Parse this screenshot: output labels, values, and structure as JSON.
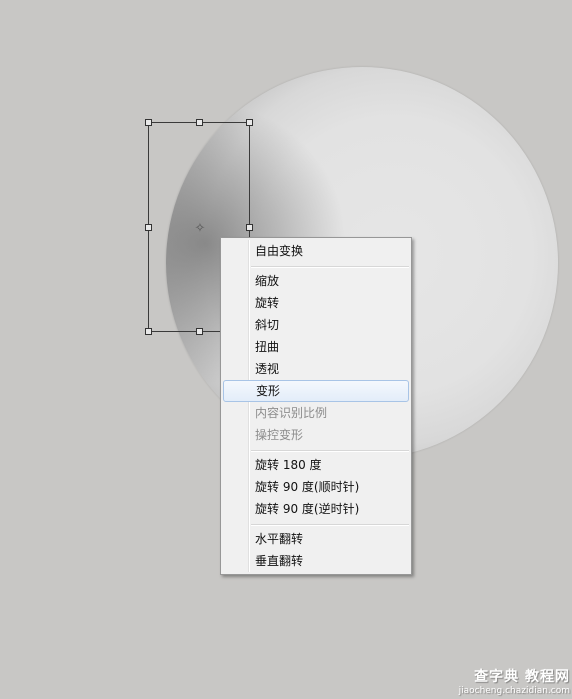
{
  "context_menu": {
    "groups": [
      {
        "items": [
          {
            "label": "自由变换",
            "enabled": true
          }
        ]
      },
      {
        "items": [
          {
            "label": "缩放",
            "enabled": true
          },
          {
            "label": "旋转",
            "enabled": true
          },
          {
            "label": "斜切",
            "enabled": true
          },
          {
            "label": "扭曲",
            "enabled": true
          },
          {
            "label": "透视",
            "enabled": true
          },
          {
            "label": "变形",
            "enabled": true,
            "highlighted": true
          },
          {
            "label": "内容识别比例",
            "enabled": false
          },
          {
            "label": "操控变形",
            "enabled": false
          }
        ]
      },
      {
        "items": [
          {
            "label": "旋转 180 度",
            "enabled": true
          },
          {
            "label": "旋转 90 度(顺时针)",
            "enabled": true
          },
          {
            "label": "旋转 90 度(逆时针)",
            "enabled": true
          }
        ]
      },
      {
        "items": [
          {
            "label": "水平翻转",
            "enabled": true
          },
          {
            "label": "垂直翻转",
            "enabled": true
          }
        ]
      }
    ]
  },
  "watermark": {
    "main": "查字典 教程网",
    "sub": "jiaocheng.chazidian.com"
  },
  "colors": {
    "background": "#c8c7c5",
    "menu_background": "#f0f0f0",
    "highlight_border": "#a8c4e6",
    "disabled_text": "#8c8c8c"
  },
  "icons": {
    "center": "crosshair-icon"
  }
}
